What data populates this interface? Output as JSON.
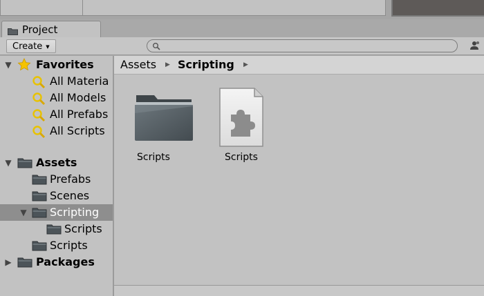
{
  "tab": {
    "title": "Project",
    "icon": "folder-icon"
  },
  "toolbar": {
    "create_label": "Create",
    "search_placeholder": "",
    "search_value": ""
  },
  "tree": {
    "favorites": {
      "label": "Favorites",
      "items": [
        "All Materia",
        "All Models",
        "All Prefabs",
        "All Scripts"
      ]
    },
    "assets": {
      "label": "Assets",
      "children": {
        "prefabs": "Prefabs",
        "scenes": "Scenes",
        "scripting": "Scripting",
        "scripting_scripts": "Scripts",
        "scripts": "Scripts"
      }
    },
    "packages": {
      "label": "Packages"
    }
  },
  "breadcrumb": {
    "root": "Assets",
    "current": "Scripting"
  },
  "content": {
    "items": [
      {
        "label": "Scripts",
        "kind": "folder",
        "icon": "folder-icon"
      },
      {
        "label": "Scripts",
        "kind": "assembly-definition",
        "icon": "puzzle-document-icon"
      }
    ]
  },
  "colors": {
    "panel_bg": "#c2c2c2",
    "selection_bg": "#8e8e8e",
    "folder_dark": "#4c5459",
    "favorites_star": "#f5c300",
    "search_lens": "#e8c200"
  }
}
